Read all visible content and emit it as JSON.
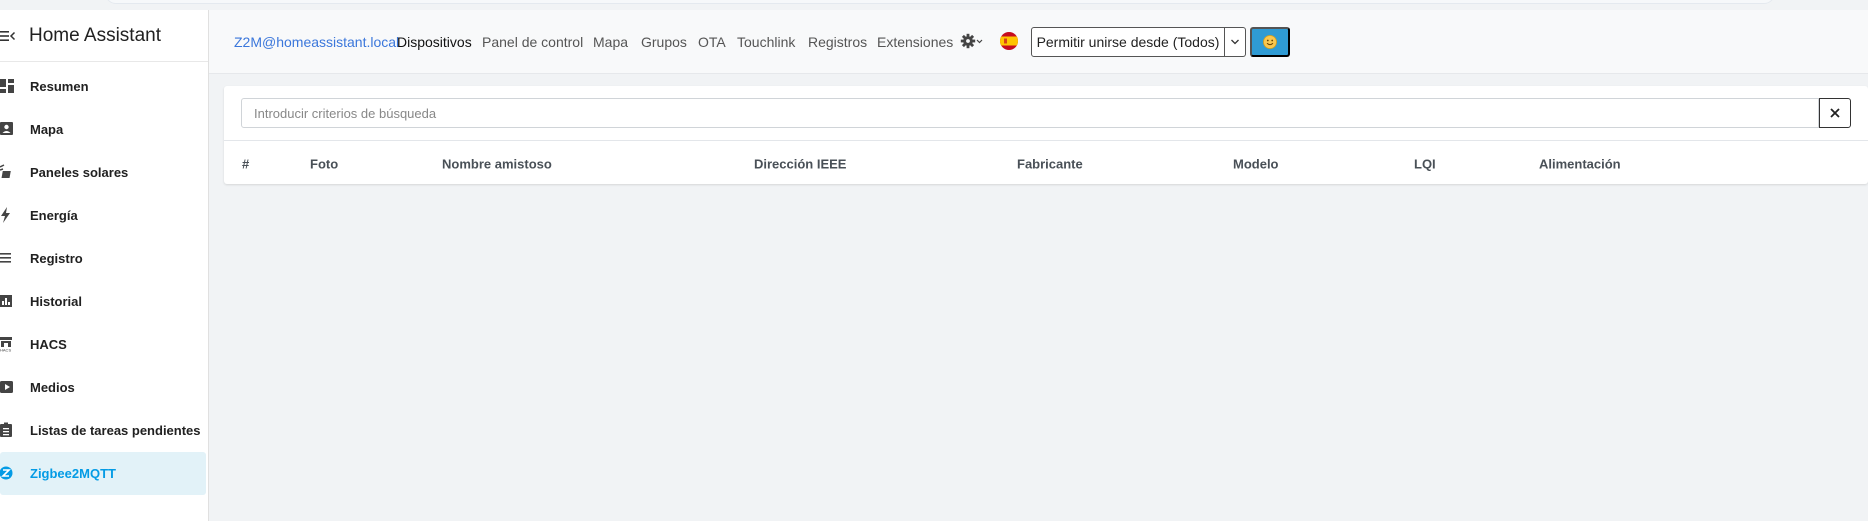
{
  "sidebar": {
    "title": "Home Assistant",
    "items": [
      {
        "label": "Resumen",
        "icon": "dashboard-icon"
      },
      {
        "label": "Mapa",
        "icon": "map-person-icon"
      },
      {
        "label": "Paneles solares",
        "icon": "solar-panel-icon"
      },
      {
        "label": "Energía",
        "icon": "lightning-icon"
      },
      {
        "label": "Registro",
        "icon": "list-icon"
      },
      {
        "label": "Historial",
        "icon": "chart-bar-icon"
      },
      {
        "label": "HACS",
        "icon": "hacs-icon"
      },
      {
        "label": "Medios",
        "icon": "media-play-icon"
      },
      {
        "label": "Listas de tareas pendientes",
        "icon": "clipboard-list-icon"
      },
      {
        "label": "Zigbee2MQTT",
        "icon": "zigbee-icon",
        "active": true
      }
    ]
  },
  "navbar": {
    "brand": "Z2M@homeassistant.local",
    "links": [
      "Dispositivos",
      "Panel de control",
      "Mapa",
      "Grupos",
      "OTA",
      "Touchlink",
      "Registros",
      "Extensiones"
    ],
    "active_link": "Dispositivos",
    "permit_join_label": "Permitir unirse desde (Todos)",
    "language_flag": "spain-flag-icon",
    "theme_button_icon": "smile-icon"
  },
  "devices": {
    "search_placeholder": "Introducir criterios de búsqueda",
    "search_value": "",
    "columns": [
      "#",
      "Foto",
      "Nombre amistoso",
      "Dirección IEEE",
      "Fabricante",
      "Modelo",
      "LQI",
      "Alimentación"
    ],
    "rows": []
  },
  "colors": {
    "accent": "#039be5",
    "active_bg": "#e2f2f8",
    "brand_link": "#3b77db",
    "smile_button": "#2f9bd4"
  }
}
